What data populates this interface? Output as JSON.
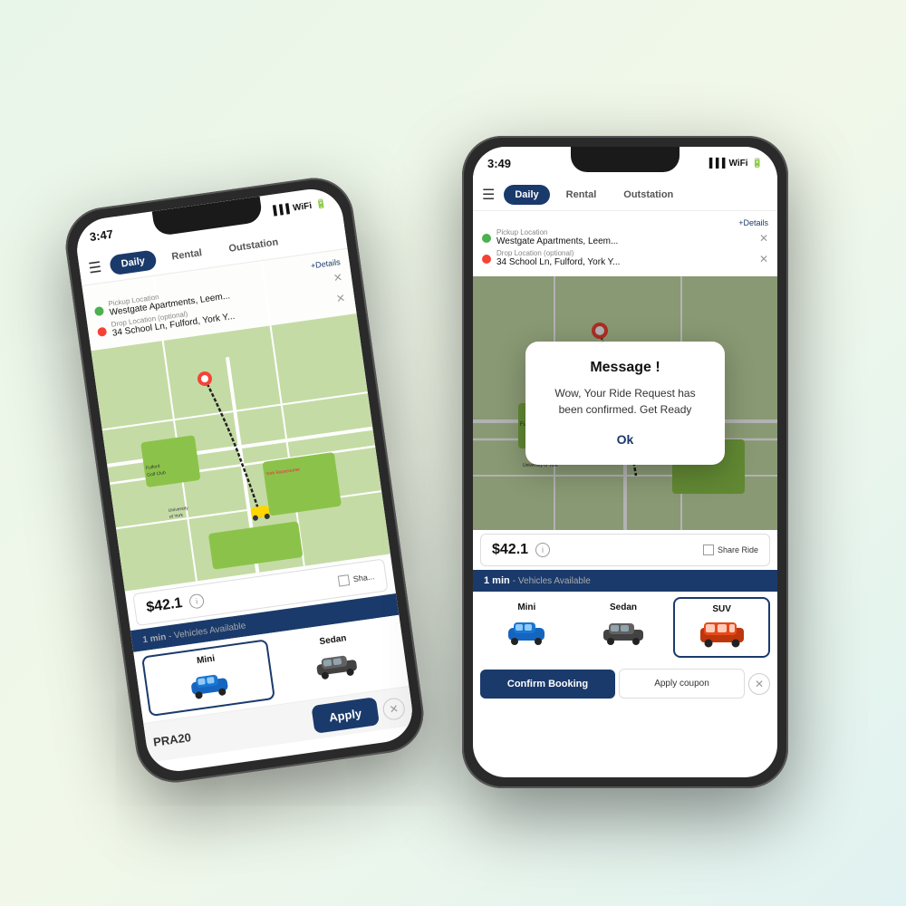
{
  "phone1": {
    "time": "3:47",
    "tabs": [
      "Daily",
      "Rental",
      "Outstation"
    ],
    "activeTab": "Daily",
    "detailsLink": "+Details",
    "pickup": {
      "label": "Pickup Location",
      "value": "Westgate Apartments, Leem..."
    },
    "drop": {
      "label": "Drop Location (optional)",
      "value": "34 School Ln, Fulford, York Y..."
    },
    "price": "$42.1",
    "availability": "1 min - Vehicles Available",
    "vehicles": [
      {
        "name": "Mini",
        "type": "mini"
      },
      {
        "name": "Sedan",
        "type": "sedan"
      }
    ],
    "couponCode": "PRA20",
    "applyLabel": "Apply"
  },
  "phone2": {
    "time": "3:49",
    "tabs": [
      "Daily",
      "Rental",
      "Outstation"
    ],
    "activeTab": "Daily",
    "detailsLink": "+Details",
    "pickup": {
      "label": "Pickup Location",
      "value": "Westgate Apartments, Leem..."
    },
    "drop": {
      "label": "Drop Location (optional)",
      "value": "34 School Ln, Fulford, York Y..."
    },
    "price": "$42.1",
    "shareRide": "Share Ride",
    "availability": "1 min - Vehicles Available",
    "vehicles": [
      {
        "name": "Mini",
        "type": "mini"
      },
      {
        "name": "Sedan",
        "type": "sedan"
      },
      {
        "name": "SUV",
        "type": "suv"
      }
    ],
    "confirmBtn": "Confirm Booking",
    "couponBtn": "Apply coupon",
    "dialog": {
      "title": "Message !",
      "message": "Wow, Your Ride Request has been confirmed. Get Ready",
      "okLabel": "Ok"
    }
  },
  "icons": {
    "hamburger": "☰",
    "close": "✕",
    "info": "i",
    "location_blue": "📍",
    "chevron": "›"
  }
}
